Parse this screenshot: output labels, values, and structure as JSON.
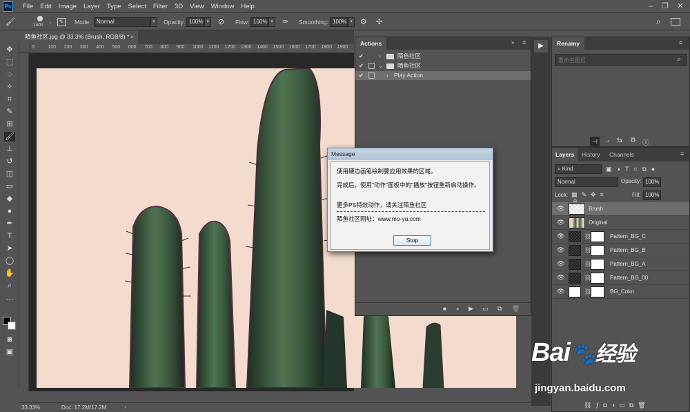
{
  "app": {
    "logo": "Ps",
    "menus": [
      "File",
      "Edit",
      "Image",
      "Layer",
      "Type",
      "Select",
      "Filter",
      "3D",
      "View",
      "Window",
      "Help"
    ]
  },
  "options": {
    "brush_size": "1400",
    "mode_label": "Mode:",
    "mode_value": "Normal",
    "opacity_label": "Opacity:",
    "opacity_value": "100%",
    "flow_label": "Flow:",
    "flow_value": "100%",
    "smoothing_label": "Smoothing:",
    "smoothing_value": "100%"
  },
  "document": {
    "tab_title": "陌鱼社区.jpg @ 33.3% (Brush, RGB/8) *",
    "ruler_ticks": [
      "0",
      "100",
      "200",
      "300",
      "400",
      "500",
      "600",
      "700",
      "800",
      "900",
      "1000",
      "1100",
      "1200",
      "1300",
      "1400",
      "1500",
      "1600",
      "1700",
      "1800",
      "1900"
    ],
    "zoom": "33.33%",
    "doc_size": "Doc: 17.2M/17.2M"
  },
  "actions_panel": {
    "tab": "Actions",
    "rows": [
      {
        "label": "陌鱼社区",
        "kind": "set"
      },
      {
        "label": "陌鱼社区",
        "kind": "action"
      },
      {
        "label": "Play Action",
        "kind": "step"
      }
    ]
  },
  "dialog": {
    "title": "Message",
    "line1": "使用硬边画笔绘制要应用效果的区域。",
    "line2": "完成后，使用\"动作\"面板中的\"播放\"按钮重新启动操作。",
    "line3": "更多PS特效动作，请关注陌鱼社区",
    "line4": "陌鱼社区网址：www.mo-yu.com",
    "stop": "Stop"
  },
  "renamy_panel": {
    "tab": "Renamy",
    "search_placeholder": "重命名图层"
  },
  "layers_panel": {
    "tabs": [
      "Layers",
      "History",
      "Channels"
    ],
    "kind": "Kind",
    "blend_mode": "Normal",
    "opacity_label": "Opacity:",
    "opacity": "100%",
    "lock_label": "Lock:",
    "fill_label": "Fill:",
    "fill": "100%",
    "layers": [
      {
        "name": "Brush",
        "selected": true
      },
      {
        "name": "Original",
        "selected": false
      },
      {
        "name": "Pattern_BG_C",
        "selected": false
      },
      {
        "name": "Pattern_BG_B",
        "selected": false
      },
      {
        "name": "Pattern_BG_A",
        "selected": false
      },
      {
        "name": "Pattern_BG_00",
        "selected": false
      },
      {
        "name": "BG_Color",
        "selected": false
      }
    ]
  },
  "watermark": {
    "brand": "Bai",
    "brand2": "经验",
    "url": "jingyan.baidu.com"
  },
  "colors": {
    "ui_bg": "#535353",
    "panel_header": "#3d3d3d",
    "canvas_bg": "#f3dccd",
    "cactus": "#3e5a3e",
    "selected_row": "#6e6e6e",
    "dialog_caption": "#c6d4e4"
  }
}
